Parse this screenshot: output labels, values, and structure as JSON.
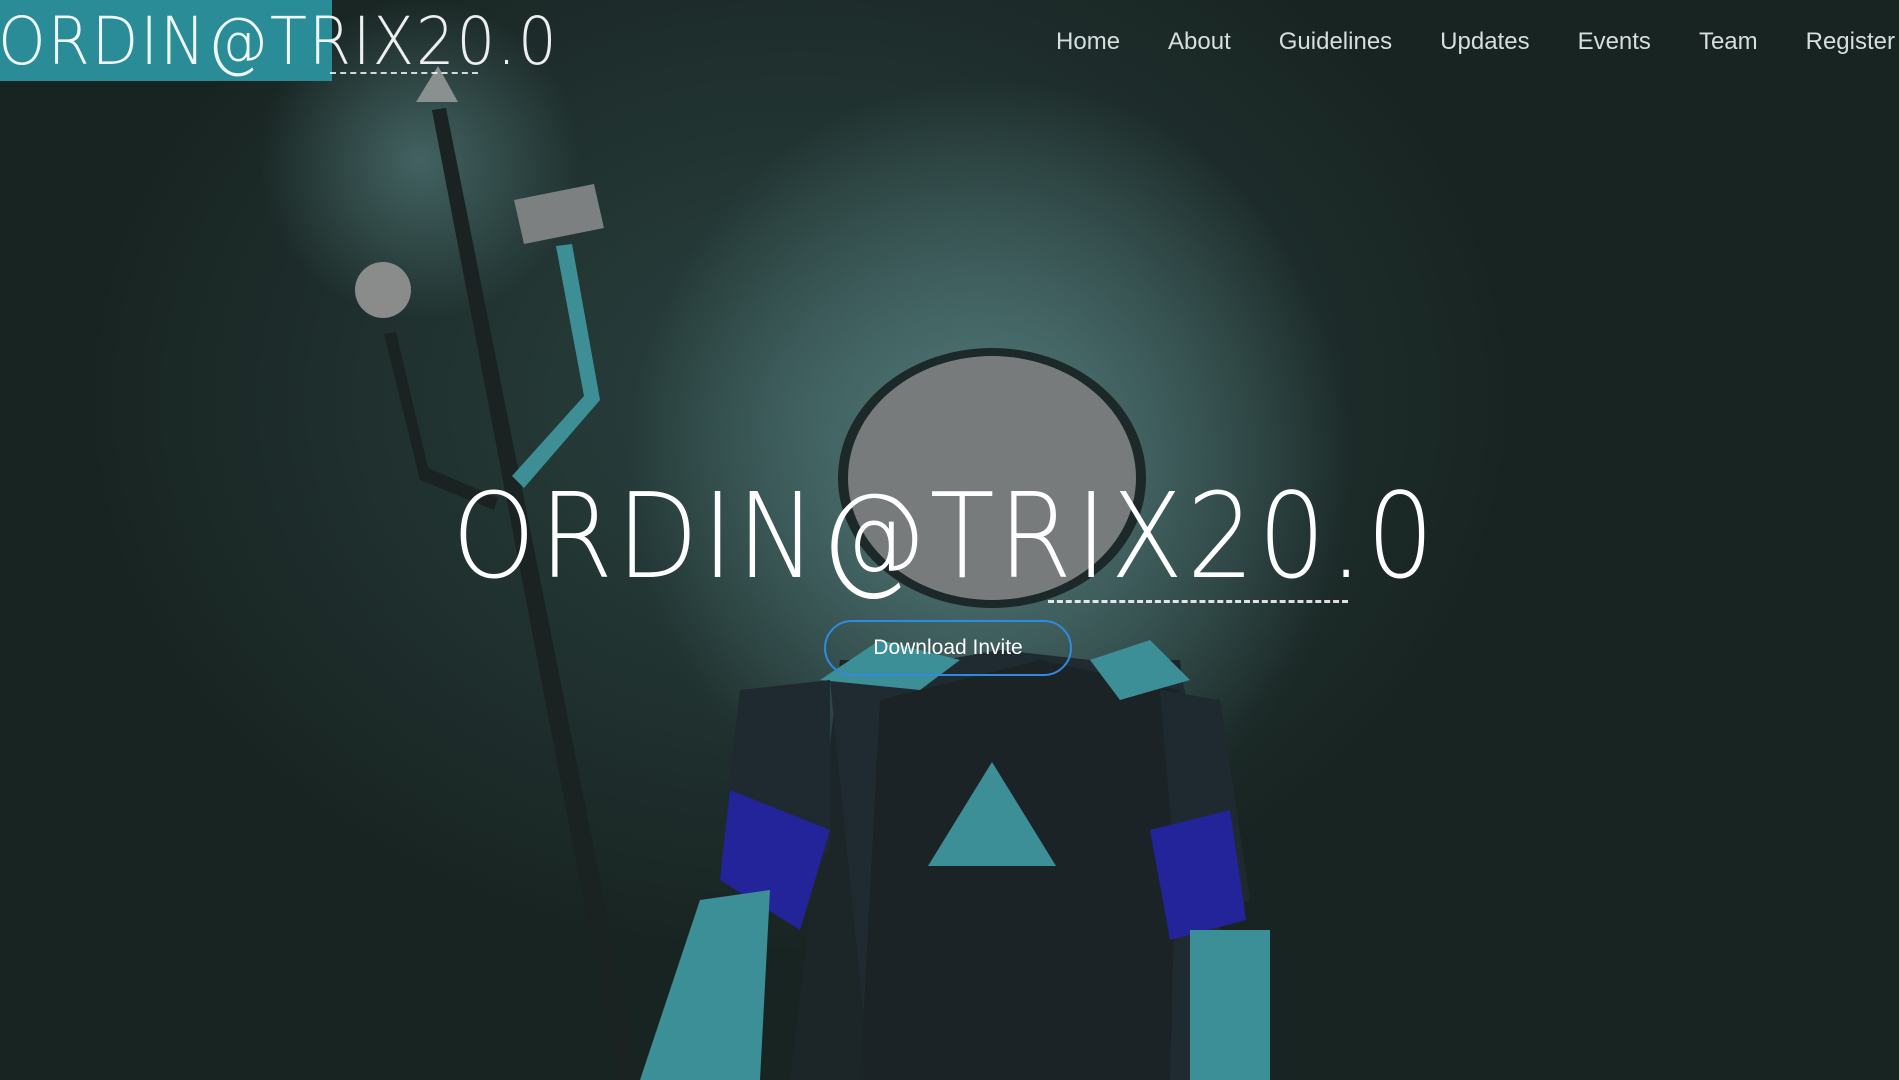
{
  "brand": {
    "logo_text": "ORDIN@TRIX20.0",
    "accent_color": "#2a8c96"
  },
  "nav": {
    "items": [
      {
        "label": "Home"
      },
      {
        "label": "About"
      },
      {
        "label": "Guidelines"
      },
      {
        "label": "Updates"
      },
      {
        "label": "Events"
      },
      {
        "label": "Team"
      },
      {
        "label": "Register"
      }
    ]
  },
  "hero": {
    "title": "ORDIN@TRIX20.0",
    "button_label": "Download Invite",
    "button_border_color": "#2f8be0"
  }
}
